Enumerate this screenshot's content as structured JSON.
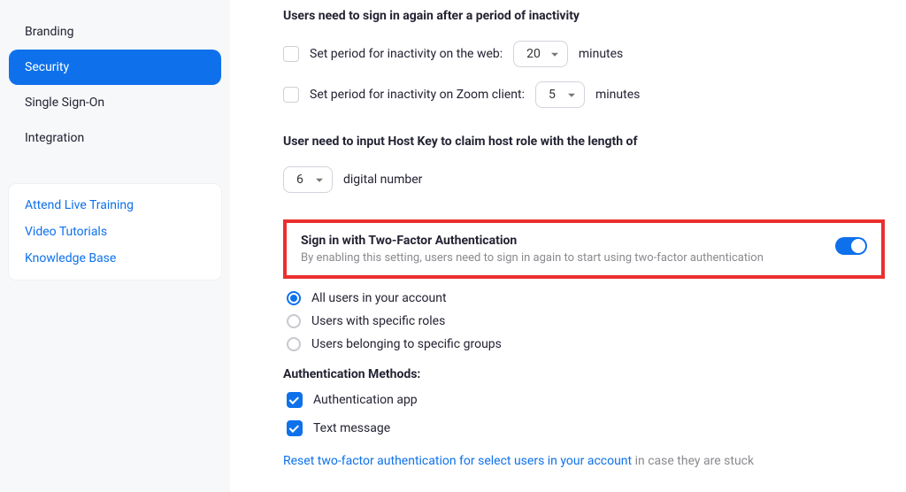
{
  "sidebar": {
    "items": [
      {
        "label": "Branding"
      },
      {
        "label": "Security"
      },
      {
        "label": "Single Sign-On"
      },
      {
        "label": "Integration"
      }
    ],
    "active_index": 1,
    "help_links": [
      "Attend Live Training",
      "Video Tutorials",
      "Knowledge Base"
    ]
  },
  "inactivity": {
    "heading": "Users need to sign in again after a period of inactivity",
    "rows": [
      {
        "label": "Set period for inactivity on the web:",
        "value": "20",
        "suffix": "minutes"
      },
      {
        "label": "Set period for inactivity on Zoom client:",
        "value": "5",
        "suffix": "minutes"
      }
    ]
  },
  "hostkey": {
    "heading": "User need to input Host Key to claim host role with the length of",
    "value": "6",
    "suffix": "digital number"
  },
  "tfa": {
    "title": "Sign in with Two-Factor Authentication",
    "description": "By enabling this setting, users need to sign in again to start using two-factor authentication",
    "enabled": true,
    "scope_options": [
      "All users in your account",
      "Users with specific roles",
      "Users belonging to specific groups"
    ],
    "scope_selected_index": 0,
    "methods_heading": "Authentication Methods:",
    "methods": [
      {
        "label": "Authentication app",
        "checked": true
      },
      {
        "label": "Text message",
        "checked": true
      }
    ],
    "reset_link": "Reset two-factor authentication for select users in your account",
    "reset_suffix": "in case they are stuck"
  }
}
